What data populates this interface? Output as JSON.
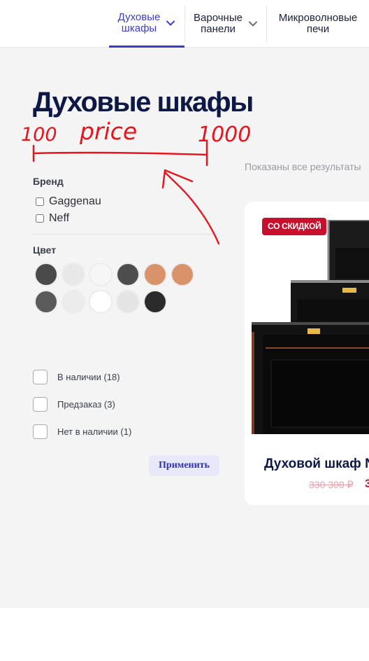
{
  "nav": {
    "items": [
      {
        "label": "Духовые\nшкафы",
        "active": true
      },
      {
        "label": "Варочные\nпанели",
        "active": false
      },
      {
        "label": "Микроволновые\nпечи",
        "active": false
      }
    ]
  },
  "page": {
    "title": "Духовые шкафы",
    "results_note": "Показаны все результаты"
  },
  "annotation": {
    "min": "100",
    "label": "price",
    "max": "1000",
    "color": "#e8141c"
  },
  "filters": {
    "brand": {
      "heading": "Бренд",
      "options": [
        {
          "label": "Gaggenau",
          "checked": false
        },
        {
          "label": "Neff",
          "checked": false
        }
      ]
    },
    "color": {
      "heading": "Цвет",
      "swatches": [
        "#4a4a4a",
        "#e8e8e8",
        "#f6f6f6",
        "#4d4d4d",
        "#d9936a",
        "#d9936a",
        "#5a5a5a",
        "#ececec",
        "#ffffff",
        "#e4e4e4",
        "#2b2b2b"
      ]
    },
    "stock": [
      {
        "label": "В наличии (18)"
      },
      {
        "label": "Предзаказ (3)"
      },
      {
        "label": "Нет в наличии (1)"
      }
    ],
    "apply_label": "Применить"
  },
  "product": {
    "badge": "СО СКИДКОЙ",
    "title": "Духовой шкаф N",
    "old_price": "330 300 ₽",
    "new_price": "3"
  },
  "colors": {
    "accent": "#3b3bd1",
    "title": "#0e1845",
    "sale": "#c8102e"
  }
}
